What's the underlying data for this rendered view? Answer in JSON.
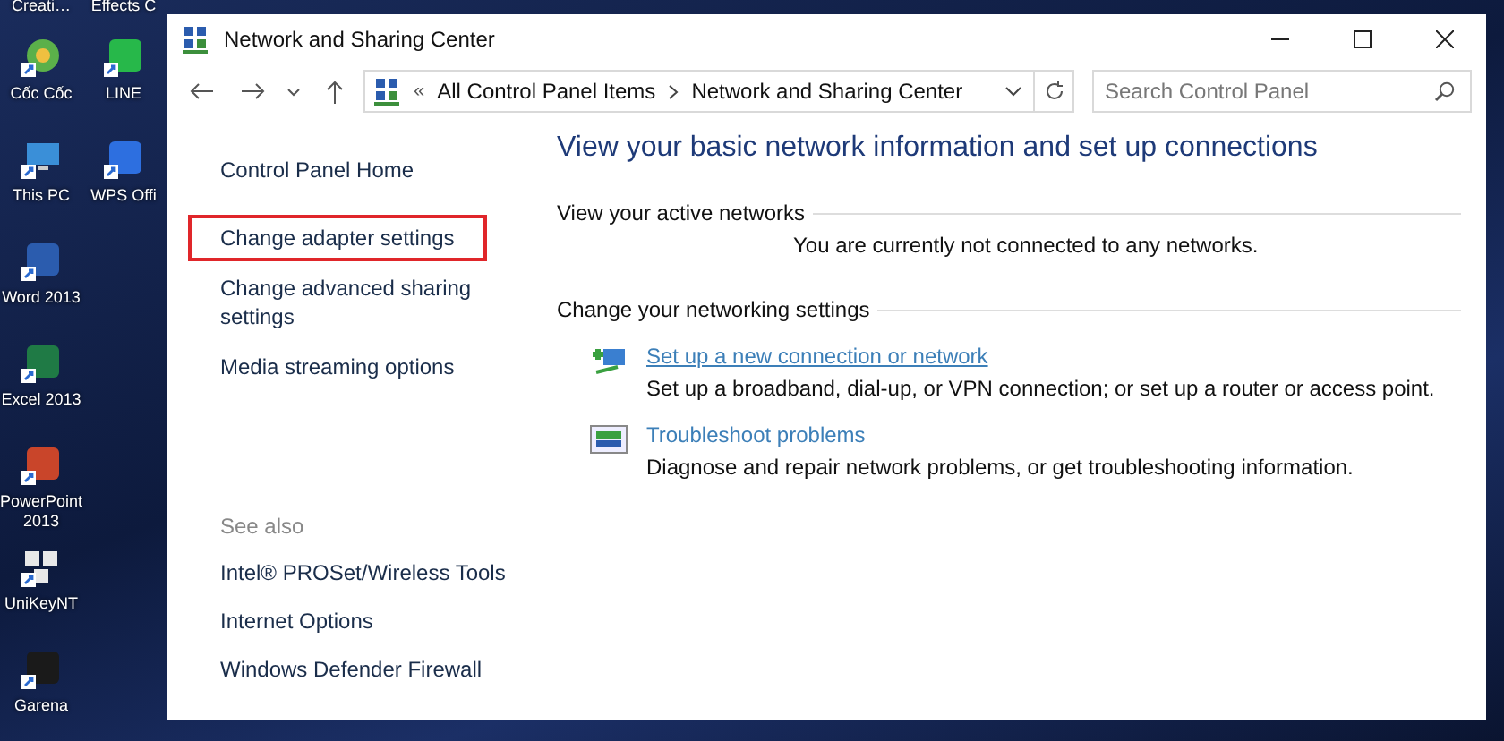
{
  "desktop": {
    "columns": [
      {
        "cut_label": "Creati…",
        "icons": [
          {
            "label": "Cốc Cốc",
            "kind": "browser"
          },
          {
            "label": "This PC",
            "kind": "computer"
          },
          {
            "label": "Word 2013",
            "kind": "word"
          },
          {
            "label": "Excel 2013",
            "kind": "excel"
          },
          {
            "label": "PowerPoint 2013",
            "kind": "powerpoint"
          },
          {
            "label": "UniKeyNT",
            "kind": "keyboard"
          },
          {
            "label": "Garena",
            "kind": "game"
          }
        ]
      },
      {
        "cut_label": "Effects C",
        "icons": [
          {
            "label": "LINE",
            "kind": "chat"
          },
          {
            "label": "WPS Offi",
            "kind": "office"
          }
        ]
      }
    ]
  },
  "window": {
    "title": "Network and Sharing Center",
    "address": {
      "overflow": "«",
      "path": [
        "All Control Panel Items",
        "Network and Sharing Center"
      ]
    },
    "search": {
      "placeholder": "Search Control Panel"
    },
    "sidebar": {
      "items": [
        {
          "label": "Control Panel Home",
          "highlighted": false
        },
        {
          "label": "Change adapter settings",
          "highlighted": true
        },
        {
          "label": "Change advanced sharing settings",
          "highlighted": false
        },
        {
          "label": "Media streaming options",
          "highlighted": false
        }
      ],
      "see_also": {
        "heading": "See also",
        "items": [
          "Intel® PROSet/Wireless Tools",
          "Internet Options",
          "Windows Defender Firewall"
        ]
      }
    },
    "main": {
      "heading": "View your basic network information and set up connections",
      "active_networks": {
        "heading": "View your active networks",
        "message": "You are currently not connected to any networks."
      },
      "settings": {
        "heading": "Change your networking settings",
        "tasks": [
          {
            "kind": "new-connection",
            "link": "Set up a new connection or network",
            "underlined": true,
            "description": "Set up a broadband, dial-up, or VPN connection; or set up a router or access point."
          },
          {
            "kind": "troubleshoot",
            "link": "Troubleshoot problems",
            "underlined": false,
            "description": "Diagnose and repair network problems, or get troubleshooting information."
          }
        ]
      }
    }
  }
}
